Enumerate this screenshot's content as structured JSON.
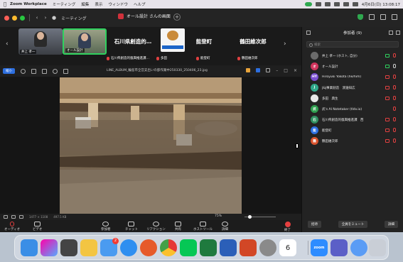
{
  "menubar": {
    "app_name": "Zoom Workplace",
    "items": [
      "ミーティング",
      "編集",
      "表示",
      "ウィンドウ",
      "ヘルプ"
    ],
    "clock": "4月6日(日) 13:08:17"
  },
  "titlebar": {
    "meeting_label": "ミーティング",
    "tab_title": "オール設計 さんの画面"
  },
  "video_strip": {
    "tiles": [
      {
        "label": "井上 孝一"
      },
      {
        "label": "オール設計"
      }
    ],
    "name_tiles": [
      "石川県創造的…",
      "能登町",
      "鶴田維次郎"
    ],
    "sub_labels": [
      "石川県創造的復興推進課…",
      "多田",
      "能登町",
      "鶴田維次郎"
    ]
  },
  "share_toolbar": {
    "view_label": "縮小",
    "filename": "LINE_ALBUM_輪島市全営支出いの部作業中250330_250406_23.jpg"
  },
  "share_status": {
    "resolution": "1477 × 1108",
    "size": "497.5 KB",
    "zoom": "75%"
  },
  "controls": [
    {
      "label": "オーディオ"
    },
    {
      "label": "ビデオ"
    },
    {
      "label": "参加者",
      "count": "9"
    },
    {
      "label": "チャット"
    },
    {
      "label": "リアクション"
    },
    {
      "label": "共有"
    },
    {
      "label": "ホストツール"
    },
    {
      "label": "詳細"
    },
    {
      "label": "終了"
    }
  ],
  "participants_panel": {
    "title": "参加者 (9)",
    "search_placeholder": "検索",
    "participants": [
      {
        "name": "井上 孝一 (ホスト, 自分)",
        "initials": "",
        "color": "#6b6b6b",
        "mic": "off",
        "cam": "on"
      },
      {
        "name": "オール設計",
        "initials": "オ",
        "color": "#d0345c",
        "mic": "on",
        "cam": "on"
      },
      {
        "name": "Hiroyuki Yokota (he/him)",
        "initials": "HY",
        "color": "#7a4fd0",
        "mic": "off",
        "cam": "off"
      },
      {
        "name": "J&J事業創造　渡邉知広",
        "initials": "J",
        "color": "#2fa88a",
        "mic": "off",
        "cam": "off"
      },
      {
        "name": "多田　典生",
        "initials": "",
        "color": "#e8e8e8",
        "mic": "off",
        "cam": "off"
      },
      {
        "name": "武's AI Notetaker (tldv.io)",
        "initials": "武",
        "color": "#2f9e4f",
        "mic": "off",
        "cam": "none"
      },
      {
        "name": "石川県創造的復興推進課　西",
        "initials": "石",
        "color": "#2f8f60",
        "mic": "off",
        "cam": "off"
      },
      {
        "name": "能登町",
        "initials": "能",
        "color": "#2d6fe0",
        "mic": "off",
        "cam": "off"
      },
      {
        "name": "鶴田維次郎",
        "initials": "鶴",
        "color": "#d9532e",
        "mic": "off",
        "cam": "off"
      }
    ],
    "buttons": {
      "invite": "招待",
      "mute_all": "全員をミュート",
      "more": "詳細"
    }
  },
  "dock": {
    "calendar_day": "6",
    "mail_badge": "2",
    "zoom_label": "zoom"
  }
}
